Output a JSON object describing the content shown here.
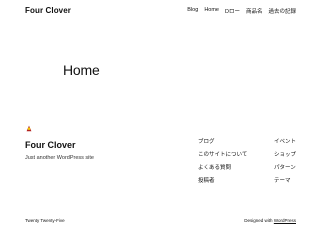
{
  "header": {
    "site_title": "Four Clover",
    "nav": [
      "Blog",
      "Home",
      "Dロー",
      "商品名",
      "過去の記録"
    ]
  },
  "main": {
    "page_title": "Home"
  },
  "footer": {
    "site_title": "Four Clover",
    "tagline": "Just another WordPress site",
    "col1": [
      "ブログ",
      "このサイトについて",
      "よくある質問",
      "投稿者"
    ],
    "col2": [
      "イベント",
      "ショップ",
      "パターン",
      "テーマ"
    ],
    "theme_credit": "Twenty Twenty-Five",
    "designed_with": "Designed with",
    "wordpress_link": "WordPress"
  }
}
